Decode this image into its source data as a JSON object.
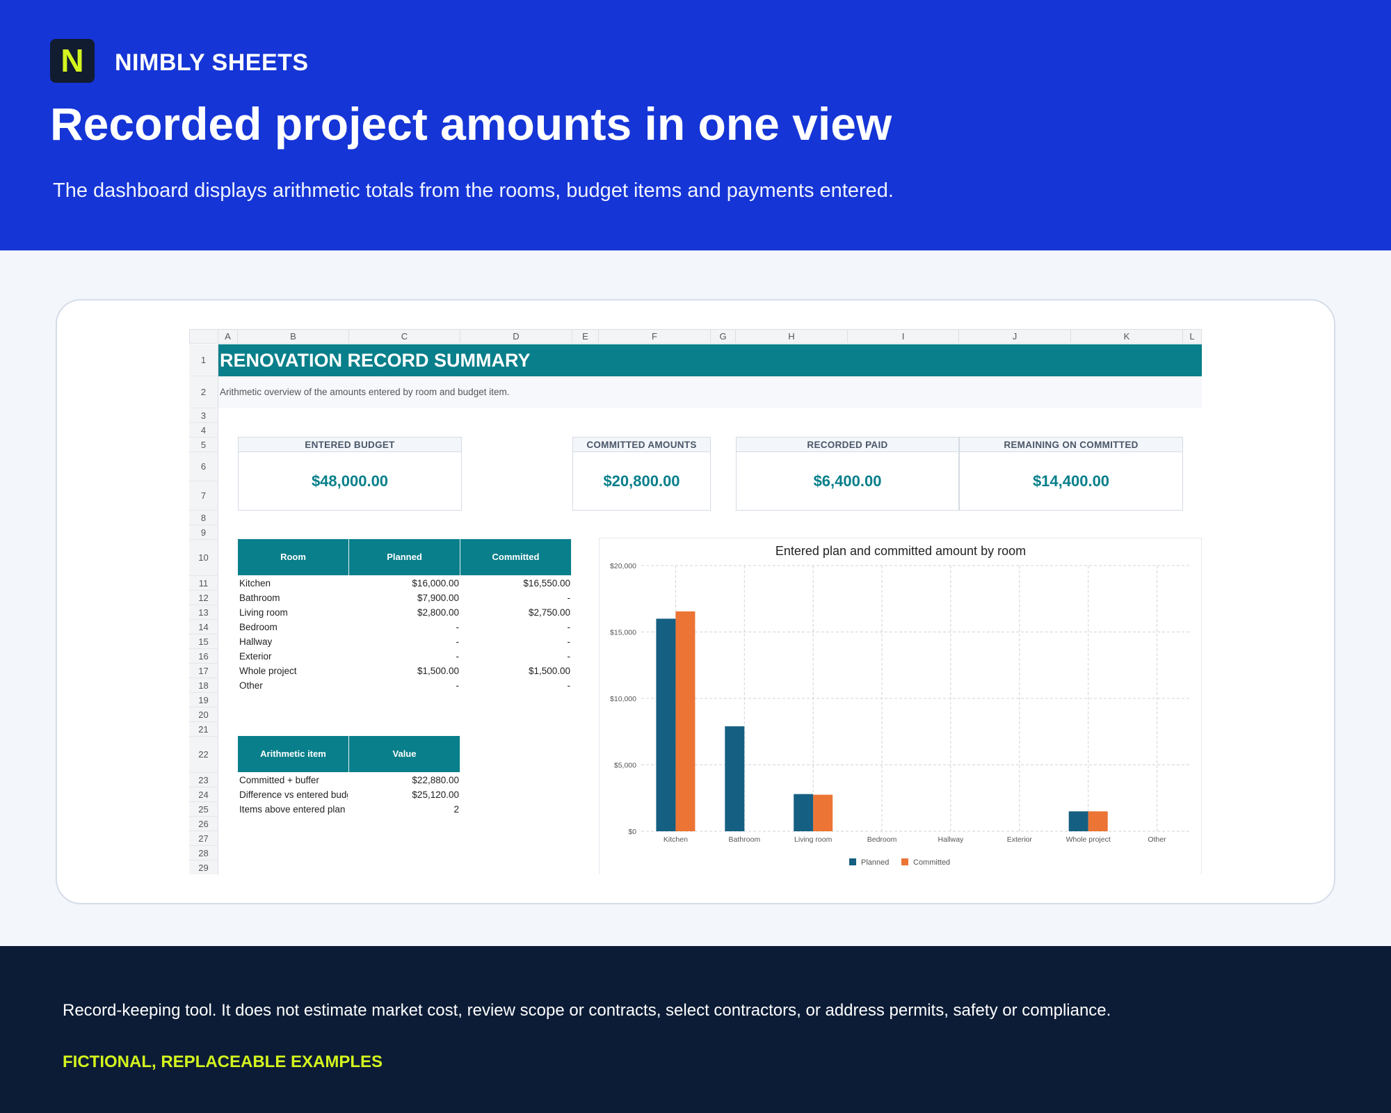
{
  "brand": {
    "logo_letter": "N",
    "name": "NIMBLY SHEETS",
    "accent": "#d4f41e"
  },
  "header": {
    "title": "Recorded project amounts in one view",
    "subtitle": "The dashboard displays arithmetic totals from the rooms, budget items and payments entered."
  },
  "sheet": {
    "columns": [
      "A",
      "B",
      "C",
      "D",
      "E",
      "F",
      "G",
      "H",
      "I",
      "J",
      "K",
      "L"
    ],
    "row_numbers": [
      "1",
      "2",
      "3",
      "4",
      "5",
      "6",
      "7",
      "8",
      "9",
      "10",
      "11",
      "12",
      "13",
      "14",
      "15",
      "16",
      "17",
      "18",
      "19",
      "20",
      "21",
      "22",
      "23",
      "24",
      "25",
      "26",
      "27",
      "28",
      "29"
    ],
    "title": "RENOVATION RECORD SUMMARY",
    "description": "Arithmetic overview of the amounts entered by room and budget item.",
    "kpis": [
      {
        "label": "ENTERED BUDGET",
        "value": "$48,000.00"
      },
      {
        "label": "COMMITTED AMOUNTS",
        "value": "$20,800.00"
      },
      {
        "label": "RECORDED PAID",
        "value": "$6,400.00"
      },
      {
        "label": "REMAINING ON COMMITTED",
        "value": "$14,400.00"
      }
    ],
    "room_table": {
      "headers": [
        "Room",
        "Planned",
        "Committed"
      ],
      "rows": [
        [
          "Kitchen",
          "$16,000.00",
          "$16,550.00"
        ],
        [
          "Bathroom",
          "$7,900.00",
          "-"
        ],
        [
          "Living room",
          "$2,800.00",
          "$2,750.00"
        ],
        [
          "Bedroom",
          "-",
          "-"
        ],
        [
          "Hallway",
          "-",
          "-"
        ],
        [
          "Exterior",
          "-",
          "-"
        ],
        [
          "Whole project",
          "$1,500.00",
          "$1,500.00"
        ],
        [
          "Other",
          "-",
          "-"
        ]
      ]
    },
    "arith_table": {
      "headers": [
        "Arithmetic item",
        "Value"
      ],
      "rows": [
        [
          "Committed + buffer",
          "$22,880.00"
        ],
        [
          "Difference vs entered budget",
          "$25,120.00"
        ],
        [
          "Items above entered plan",
          "2"
        ]
      ]
    }
  },
  "chart_data": {
    "type": "bar",
    "title": "Entered plan and committed amount by room",
    "categories": [
      "Kitchen",
      "Bathroom",
      "Living room",
      "Bedroom",
      "Hallway",
      "Exterior",
      "Whole project",
      "Other"
    ],
    "series": [
      {
        "name": "Planned",
        "color": "#155f82",
        "values": [
          16000,
          7900,
          2800,
          0,
          0,
          0,
          1500,
          0
        ]
      },
      {
        "name": "Committed",
        "color": "#ec7434",
        "values": [
          16550,
          0,
          2750,
          0,
          0,
          0,
          1500,
          0
        ]
      }
    ],
    "ylim": [
      0,
      20000
    ],
    "yticks": [
      0,
      5000,
      10000,
      15000,
      20000
    ],
    "ytick_labels": [
      "$0",
      "$5,000",
      "$10,000",
      "$15,000",
      "$20,000"
    ],
    "grid": true,
    "legend": "bottom"
  },
  "footer": {
    "disclaimer": "Record-keeping tool. It does not estimate market cost, review scope or contracts, select contractors, or address permits, safety or compliance.",
    "tag": "FICTIONAL, REPLACEABLE EXAMPLES"
  }
}
